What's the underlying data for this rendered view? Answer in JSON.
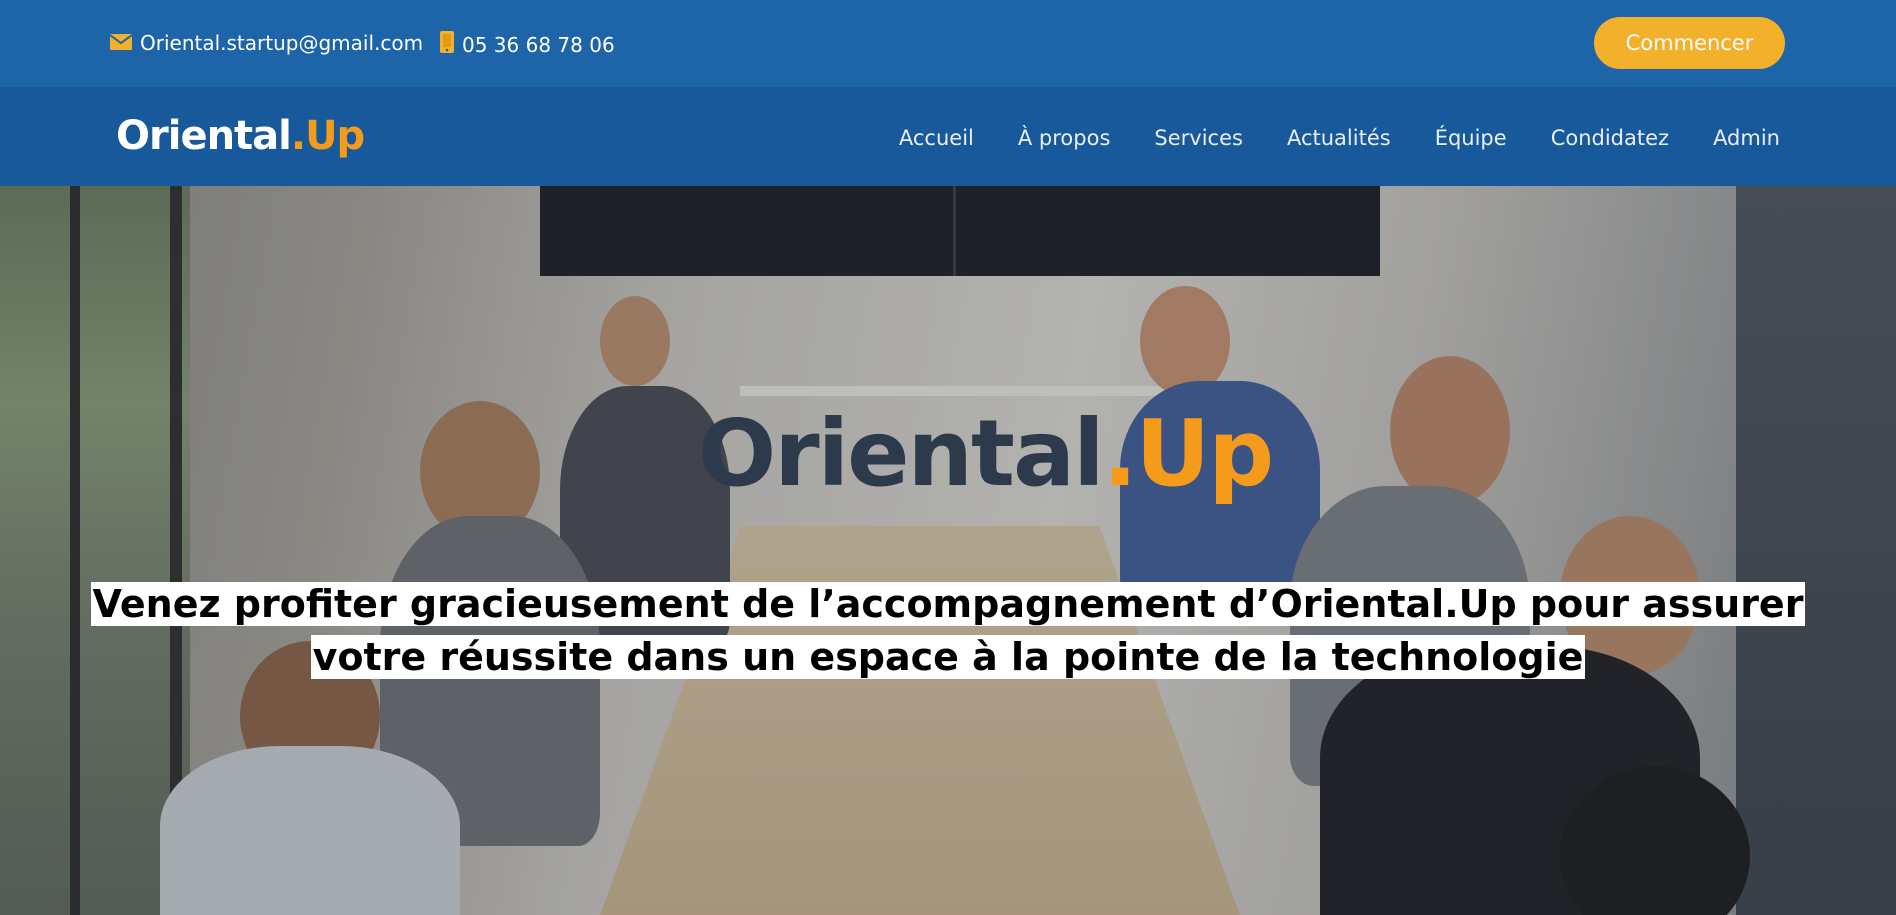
{
  "topbar": {
    "email": "Oriental.startup@gmail.com",
    "phone": "05 36 68 78 06",
    "start_button": "Commencer",
    "email_icon": "envelope-icon",
    "phone_icon": "mobile-phone-icon"
  },
  "brand": {
    "name_main": "Oriental",
    "name_accent": ".Up",
    "accent_color": "#f49b1c",
    "primary_color": "#1d64a8",
    "button_color": "#f3b02a"
  },
  "nav": {
    "items": [
      {
        "label": "Accueil"
      },
      {
        "label": "À propos"
      },
      {
        "label": "Services"
      },
      {
        "label": "Actualités"
      },
      {
        "label": "Équipe"
      },
      {
        "label": "Condidatez"
      },
      {
        "label": "Admin"
      }
    ]
  },
  "hero": {
    "logo_main": "Oriental",
    "logo_accent": ".Up",
    "tagline_line1": "Venez profiter gracieusement de l’accompagnement d’Oriental.Up pour assurer",
    "tagline_line2": "votre réussite dans un espace à la pointe de la technologie"
  }
}
